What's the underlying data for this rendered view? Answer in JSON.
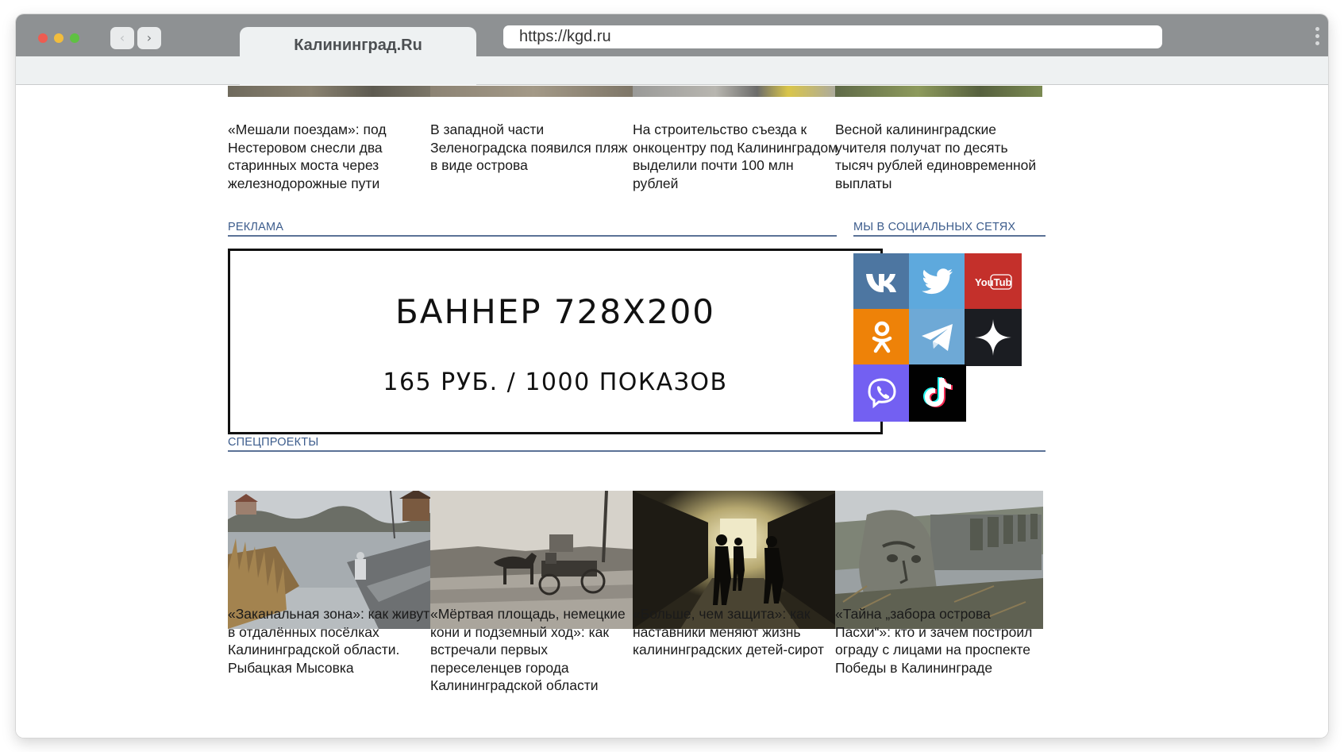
{
  "browser": {
    "tab_title": "Калининград.Ru",
    "url": "https://kgd.ru",
    "back_glyph": "‹",
    "forward_glyph": "›"
  },
  "top_news": [
    {
      "title": "«Мешали поездам»: под Нестеровом снесли два старинных моста через железнодорожные пути"
    },
    {
      "title": "В западной части Зеленоградска появился пляж в виде острова"
    },
    {
      "title": "На строительство съезда к онкоцентру под Калининградом выделили почти 100 млн рублей"
    },
    {
      "title": "Весной калининградские учителя получат по десять тысяч рублей единовременной выплаты"
    }
  ],
  "ads": {
    "section_label": "РЕКЛАМА",
    "banner_title": "БАННЕР 728Х200",
    "banner_price": "165 РУБ. / 1000 ПОКАЗОВ"
  },
  "social": {
    "section_label": "МЫ В СОЦИАЛЬНЫХ СЕТЯХ",
    "items": [
      {
        "icon": "vk-icon",
        "color": "#4d76a1"
      },
      {
        "icon": "twitter-icon",
        "color": "#5ea9dd"
      },
      {
        "icon": "youtube-icon",
        "color": "#c4302b",
        "logo_text": "YouTube"
      },
      {
        "icon": "odnoklassniki-icon",
        "color": "#ee8208"
      },
      {
        "icon": "telegram-icon",
        "color": "#6ea9d6"
      },
      {
        "icon": "zen-icon",
        "color": "#1b1d22"
      },
      {
        "icon": "viber-icon",
        "color": "#7360f2"
      },
      {
        "icon": "tiktok-icon",
        "color": "#010101"
      }
    ]
  },
  "special_projects": {
    "section_label": "СПЕЦПРОЕКТЫ",
    "items": [
      {
        "title": "«Заканальная зона»: как живут в отдалённых посёлках Калининградской области. Рыбацкая Мысовка"
      },
      {
        "title": "«Мёртвая площадь, немецкие кони и подземный ход»: как встречали первых переселенцев города Калининградской области"
      },
      {
        "title": "«Больше, чем защита»: как наставники меняют жизнь калининградских детей-сирот"
      },
      {
        "title": "«Тайна „забора острова Пасхи“»: кто и зачем построил ограду с лицами на проспекте Победы в Калининграде"
      }
    ]
  }
}
